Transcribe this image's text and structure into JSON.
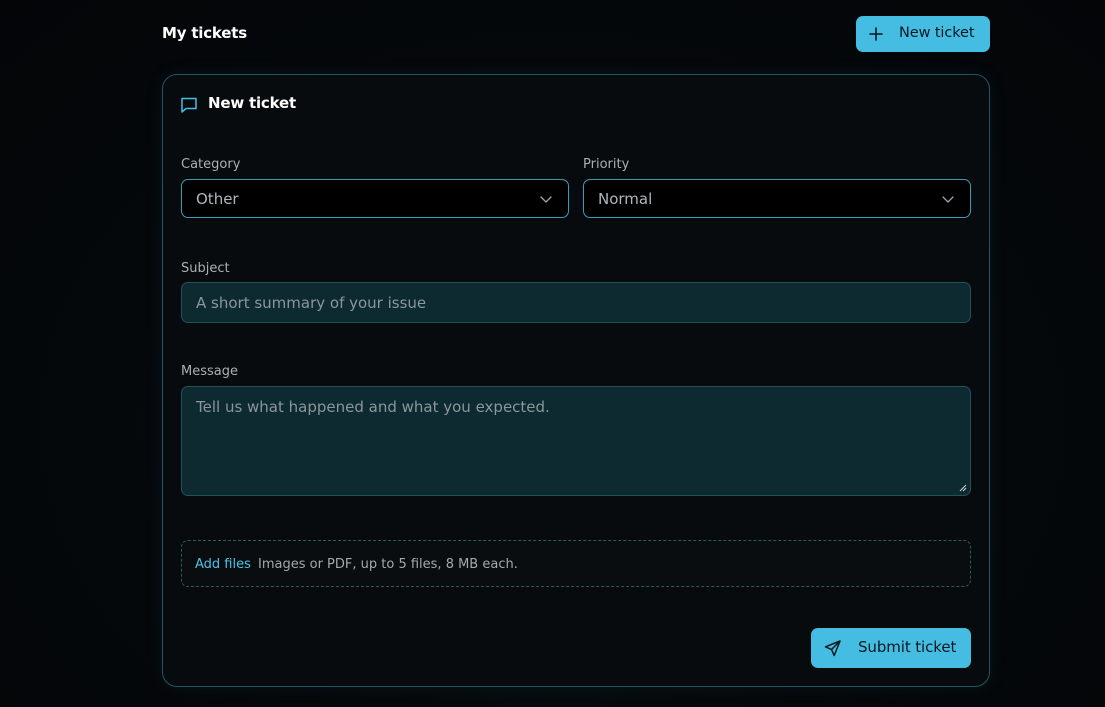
{
  "header": {
    "title": "My tickets",
    "new_ticket_button": "New ticket",
    "new_ticket_icon": "plus-icon"
  },
  "form": {
    "title": "New ticket",
    "title_icon": "message-square-icon",
    "category": {
      "label": "Category",
      "value": "Other"
    },
    "priority": {
      "label": "Priority",
      "value": "Normal"
    },
    "subject": {
      "label": "Subject",
      "placeholder": "A short summary of your issue"
    },
    "message": {
      "label": "Message",
      "placeholder": "Tell us what happened and what you expected."
    },
    "attachments": {
      "add_label": "Add files",
      "hint": "Images or PDF, up to 5 files, 8 MB each."
    },
    "submit_button": "Submit ticket",
    "submit_icon": "send-icon"
  },
  "colors": {
    "accent": "#45bde3",
    "border": "#1f5662",
    "background": "#05080b",
    "input_background": "#0d2a30"
  }
}
